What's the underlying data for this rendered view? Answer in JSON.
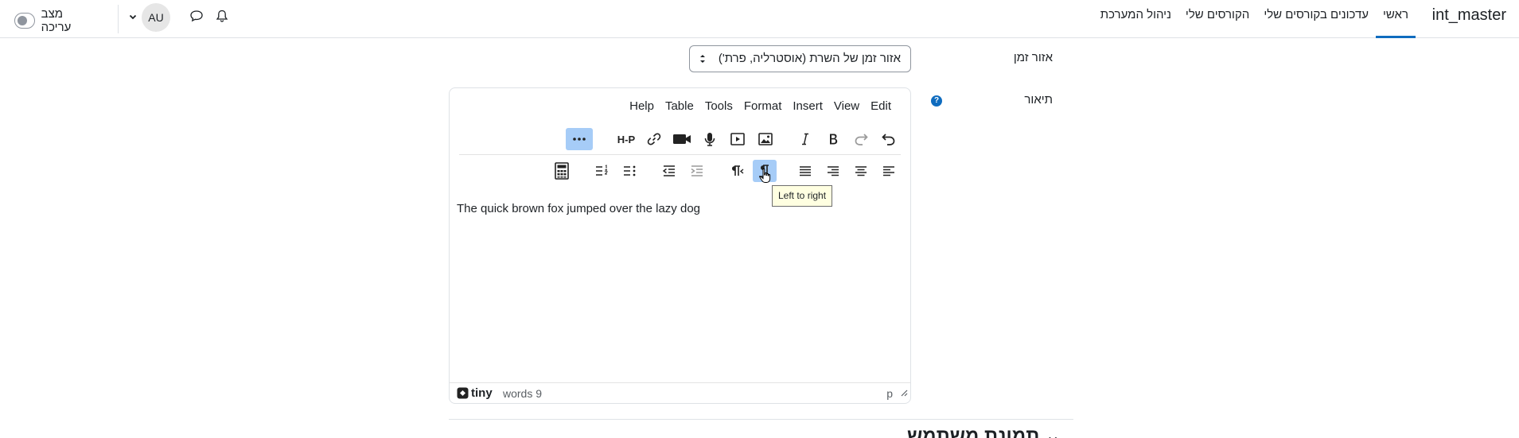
{
  "navbar": {
    "brand": "int_master",
    "items": [
      {
        "label": "ראשי",
        "active": true
      },
      {
        "label": "עדכונים בקורסים שלי",
        "active": false
      },
      {
        "label": "הקורסים שלי",
        "active": false
      },
      {
        "label": "ניהול המערכת",
        "active": false
      }
    ],
    "user_initials": "AU",
    "edit_mode_label": "מצב עריכה",
    "icons": [
      "bell-icon",
      "chat-icon",
      "chevron-down-icon"
    ]
  },
  "form": {
    "timezone_label": "אזור זמן",
    "timezone_value": "אזור זמן של השרת (אוסטרליה, פרת')",
    "description_label": "תיאור"
  },
  "editor": {
    "menus": [
      "Edit",
      "View",
      "Insert",
      "Format",
      "Tools",
      "Table",
      "Help"
    ],
    "content": "The quick brown fox jumped over the lazy dog",
    "brand": "tiny",
    "word_count": "words 9",
    "path": "p",
    "tooltip": "Left to right",
    "h5p_label": "H-P"
  },
  "section": {
    "heading": "תמונת משתמש"
  },
  "colors": {
    "accent": "#0f6cbf",
    "toolbar_active": "#a6ccf7",
    "tooltip_bg": "#ffffe1"
  }
}
